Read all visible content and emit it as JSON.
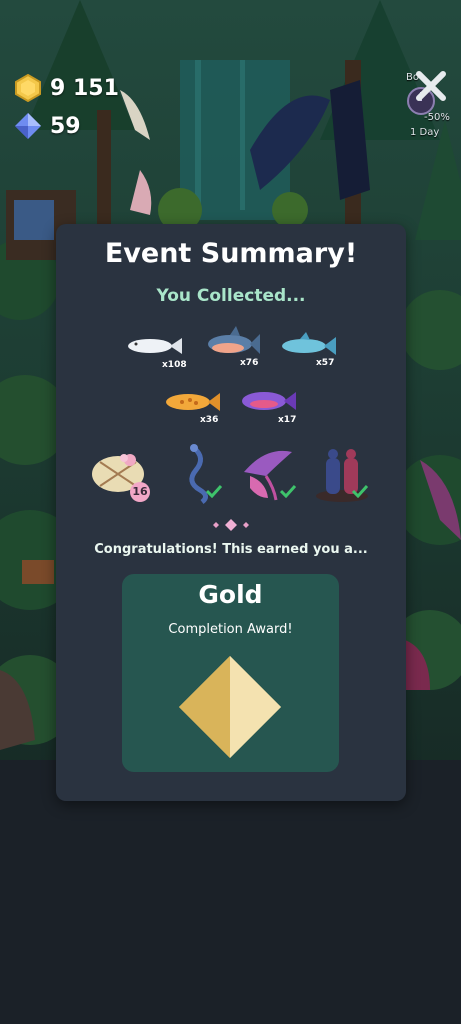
{
  "hud": {
    "coins": "9 151",
    "gems": "59",
    "boost_top": "Bo",
    "boost_pct": "-50%",
    "boost_duration": "1 Day"
  },
  "summary": {
    "title": "Event Summary!",
    "subtitle": "You Collected...",
    "fish": [
      {
        "name": "white-fish",
        "qty": "x108"
      },
      {
        "name": "shark-fish",
        "qty": "x76"
      },
      {
        "name": "blue-fish",
        "qty": "x57"
      },
      {
        "name": "yellow-fish",
        "qty": "x36"
      },
      {
        "name": "purple-fish",
        "qty": "x17"
      }
    ],
    "egg_count": "16",
    "congrats": "Congratulations! This earned you a..."
  },
  "award": {
    "tier": "Gold",
    "label": "Completion Award!"
  },
  "colors": {
    "panel": "#2a3340",
    "award_bg": "#265650",
    "subtitle": "#a9e5c9",
    "check": "#3ec36b",
    "gold": "#e3c677"
  }
}
